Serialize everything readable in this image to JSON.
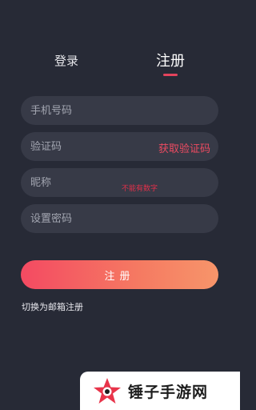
{
  "tabs": {
    "login_label": "登录",
    "register_label": "注册",
    "active": "register"
  },
  "form": {
    "phone_placeholder": "手机号码",
    "code_placeholder": "验证码",
    "get_code_label": "获取验证码",
    "nickname_placeholder": "昵称",
    "nickname_hint": "不能有数字",
    "password_placeholder": "设置密码",
    "submit_label": "注册",
    "switch_label": "切换为邮箱注册"
  },
  "watermark": {
    "text": "锤子手游网"
  },
  "colors": {
    "background": "#272a36",
    "field": "#373a47",
    "accent": "#e4445d",
    "gradient_start": "#f44a62",
    "gradient_end": "#f7956a"
  }
}
